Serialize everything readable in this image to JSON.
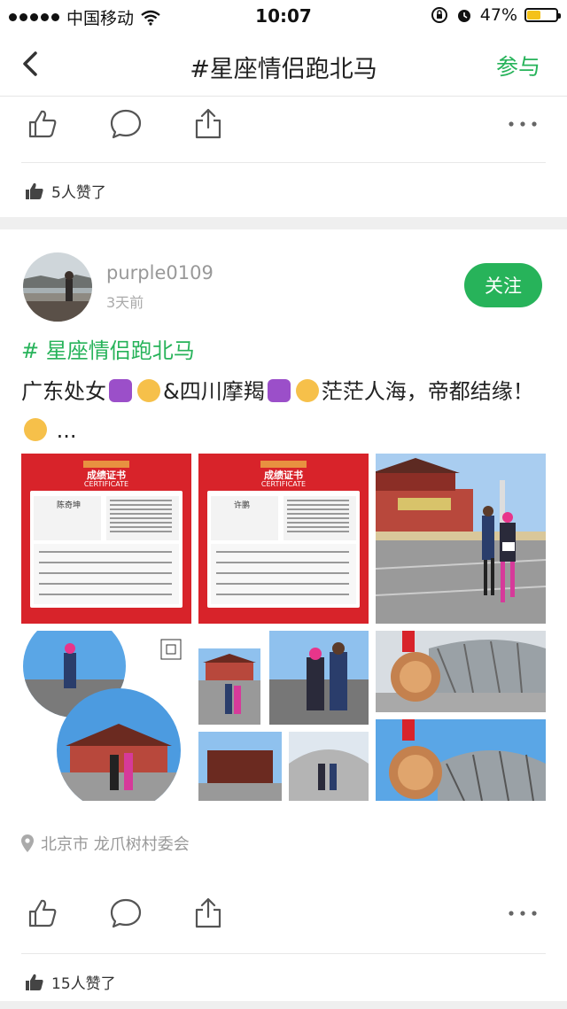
{
  "status_bar": {
    "carrier": "中国移动",
    "time": "10:07",
    "battery": "47%",
    "battery_level": 0.47
  },
  "nav": {
    "title": "#星座情侣跑北马",
    "join_label": "参与",
    "back_icon": "chevron-left-icon"
  },
  "first_post": {
    "likes_text": "5人赞了"
  },
  "post": {
    "username": "purple0109",
    "time_ago": "3天前",
    "follow_label": "关注",
    "hashtag": "# 星座情侣跑北马",
    "text_part1": "广东处女",
    "text_part2": "&四川摩羯",
    "text_part3": "茫茫人海，帝都结缘！",
    "text_more": "...",
    "location": "北京市  龙爪树村委会",
    "likes_text": "15人赞了",
    "photos": [
      {
        "kind": "certificate",
        "title": "成绩证书",
        "subtitle": "CERTIFICATE",
        "name": "陈奇坤"
      },
      {
        "kind": "certificate",
        "title": "成绩证书",
        "subtitle": "CERTIFICATE",
        "name": "许鹏"
      },
      {
        "kind": "photo",
        "scene": "runners-tiananmen"
      },
      {
        "kind": "photo",
        "scene": "collage-circles"
      },
      {
        "kind": "photo",
        "scene": "collage-runners"
      },
      {
        "kind": "photo",
        "scene": "medal-stadium"
      },
      {
        "kind": "photo",
        "scene": "collage-gate"
      },
      {
        "kind": "photo",
        "scene": "medal-birdsnest"
      }
    ]
  },
  "colors": {
    "accent": "#27b35a",
    "cert_red": "#d8232a"
  }
}
